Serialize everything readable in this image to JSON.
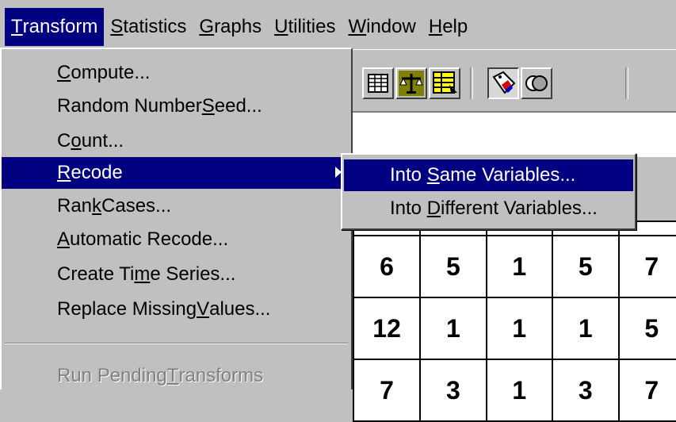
{
  "menubar": {
    "items": [
      {
        "pre": "",
        "key": "T",
        "post": "ransform",
        "active": true
      },
      {
        "pre": "",
        "key": "S",
        "post": "tatistics",
        "active": false
      },
      {
        "pre": "",
        "key": "G",
        "post": "raphs",
        "active": false
      },
      {
        "pre": "",
        "key": "U",
        "post": "tilities",
        "active": false
      },
      {
        "pre": "",
        "key": "W",
        "post": "indow",
        "active": false
      },
      {
        "pre": "",
        "key": "H",
        "post": "elp",
        "active": false
      }
    ]
  },
  "transform_menu": {
    "items": [
      {
        "pre": "",
        "key": "C",
        "post": "ompute..."
      },
      {
        "pre": "Random Number ",
        "key": "S",
        "post": "eed..."
      },
      {
        "pre": "C",
        "key": "o",
        "post": "unt..."
      },
      {
        "pre": "",
        "key": "R",
        "post": "ecode",
        "highlighted": true,
        "has_submenu": true
      },
      {
        "pre": "Ran",
        "key": "k",
        "post": " Cases..."
      },
      {
        "pre": "",
        "key": "A",
        "post": "utomatic Recode..."
      },
      {
        "pre": "Create Ti",
        "key": "m",
        "post": "e Series..."
      },
      {
        "pre": "Replace Missing ",
        "key": "V",
        "post": "alues..."
      },
      {
        "pre": "Run Pending ",
        "key": "T",
        "post": "ransforms",
        "disabled": true
      }
    ]
  },
  "recode_submenu": {
    "items": [
      {
        "pre": "Into ",
        "key": "S",
        "post": "ame Variables...",
        "highlighted": true
      },
      {
        "pre": "Into ",
        "key": "D",
        "post": "ifferent Variables..."
      }
    ]
  },
  "toolbar": {
    "icons": [
      "data-grid-icon",
      "scale-icon",
      "list-icon",
      "value-labels-icon",
      "sets-icon"
    ]
  },
  "grid": {
    "rows": [
      [
        "6",
        "5",
        "1",
        "5",
        "7"
      ],
      [
        "12",
        "1",
        "1",
        "1",
        "5"
      ],
      [
        "7",
        "3",
        "1",
        "3",
        "7"
      ]
    ]
  }
}
